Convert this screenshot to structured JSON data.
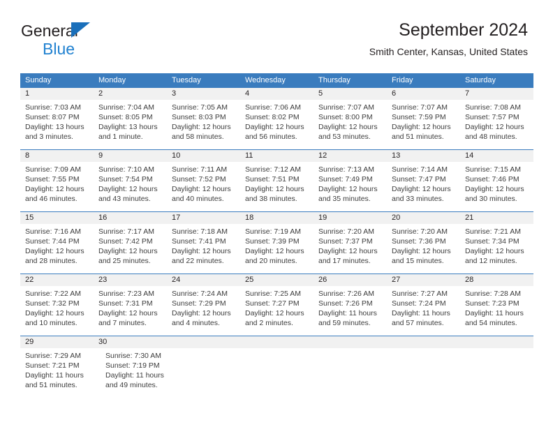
{
  "brand": {
    "name_part1": "General",
    "name_part2": "Blue",
    "triangle_color": "#1a6fba",
    "blue_color": "#2081d0"
  },
  "header": {
    "title": "September 2024",
    "subtitle": "Smith Center, Kansas, United States"
  },
  "theme": {
    "header_blue": "#3a7cbe",
    "daynum_gray": "#f1f1f1",
    "text_dark": "#231f20",
    "text_body": "#3c3c3c"
  },
  "weekdays": [
    "Sunday",
    "Monday",
    "Tuesday",
    "Wednesday",
    "Thursday",
    "Friday",
    "Saturday"
  ],
  "weeks": [
    {
      "days": [
        {
          "number": "1",
          "sunrise": "Sunrise: 7:03 AM",
          "sunset": "Sunset: 8:07 PM",
          "daylight_line1": "Daylight: 13 hours",
          "daylight_line2": "and 3 minutes."
        },
        {
          "number": "2",
          "sunrise": "Sunrise: 7:04 AM",
          "sunset": "Sunset: 8:05 PM",
          "daylight_line1": "Daylight: 13 hours",
          "daylight_line2": "and 1 minute."
        },
        {
          "number": "3",
          "sunrise": "Sunrise: 7:05 AM",
          "sunset": "Sunset: 8:03 PM",
          "daylight_line1": "Daylight: 12 hours",
          "daylight_line2": "and 58 minutes."
        },
        {
          "number": "4",
          "sunrise": "Sunrise: 7:06 AM",
          "sunset": "Sunset: 8:02 PM",
          "daylight_line1": "Daylight: 12 hours",
          "daylight_line2": "and 56 minutes."
        },
        {
          "number": "5",
          "sunrise": "Sunrise: 7:07 AM",
          "sunset": "Sunset: 8:00 PM",
          "daylight_line1": "Daylight: 12 hours",
          "daylight_line2": "and 53 minutes."
        },
        {
          "number": "6",
          "sunrise": "Sunrise: 7:07 AM",
          "sunset": "Sunset: 7:59 PM",
          "daylight_line1": "Daylight: 12 hours",
          "daylight_line2": "and 51 minutes."
        },
        {
          "number": "7",
          "sunrise": "Sunrise: 7:08 AM",
          "sunset": "Sunset: 7:57 PM",
          "daylight_line1": "Daylight: 12 hours",
          "daylight_line2": "and 48 minutes."
        }
      ]
    },
    {
      "days": [
        {
          "number": "8",
          "sunrise": "Sunrise: 7:09 AM",
          "sunset": "Sunset: 7:55 PM",
          "daylight_line1": "Daylight: 12 hours",
          "daylight_line2": "and 46 minutes."
        },
        {
          "number": "9",
          "sunrise": "Sunrise: 7:10 AM",
          "sunset": "Sunset: 7:54 PM",
          "daylight_line1": "Daylight: 12 hours",
          "daylight_line2": "and 43 minutes."
        },
        {
          "number": "10",
          "sunrise": "Sunrise: 7:11 AM",
          "sunset": "Sunset: 7:52 PM",
          "daylight_line1": "Daylight: 12 hours",
          "daylight_line2": "and 40 minutes."
        },
        {
          "number": "11",
          "sunrise": "Sunrise: 7:12 AM",
          "sunset": "Sunset: 7:51 PM",
          "daylight_line1": "Daylight: 12 hours",
          "daylight_line2": "and 38 minutes."
        },
        {
          "number": "12",
          "sunrise": "Sunrise: 7:13 AM",
          "sunset": "Sunset: 7:49 PM",
          "daylight_line1": "Daylight: 12 hours",
          "daylight_line2": "and 35 minutes."
        },
        {
          "number": "13",
          "sunrise": "Sunrise: 7:14 AM",
          "sunset": "Sunset: 7:47 PM",
          "daylight_line1": "Daylight: 12 hours",
          "daylight_line2": "and 33 minutes."
        },
        {
          "number": "14",
          "sunrise": "Sunrise: 7:15 AM",
          "sunset": "Sunset: 7:46 PM",
          "daylight_line1": "Daylight: 12 hours",
          "daylight_line2": "and 30 minutes."
        }
      ]
    },
    {
      "days": [
        {
          "number": "15",
          "sunrise": "Sunrise: 7:16 AM",
          "sunset": "Sunset: 7:44 PM",
          "daylight_line1": "Daylight: 12 hours",
          "daylight_line2": "and 28 minutes."
        },
        {
          "number": "16",
          "sunrise": "Sunrise: 7:17 AM",
          "sunset": "Sunset: 7:42 PM",
          "daylight_line1": "Daylight: 12 hours",
          "daylight_line2": "and 25 minutes."
        },
        {
          "number": "17",
          "sunrise": "Sunrise: 7:18 AM",
          "sunset": "Sunset: 7:41 PM",
          "daylight_line1": "Daylight: 12 hours",
          "daylight_line2": "and 22 minutes."
        },
        {
          "number": "18",
          "sunrise": "Sunrise: 7:19 AM",
          "sunset": "Sunset: 7:39 PM",
          "daylight_line1": "Daylight: 12 hours",
          "daylight_line2": "and 20 minutes."
        },
        {
          "number": "19",
          "sunrise": "Sunrise: 7:20 AM",
          "sunset": "Sunset: 7:37 PM",
          "daylight_line1": "Daylight: 12 hours",
          "daylight_line2": "and 17 minutes."
        },
        {
          "number": "20",
          "sunrise": "Sunrise: 7:20 AM",
          "sunset": "Sunset: 7:36 PM",
          "daylight_line1": "Daylight: 12 hours",
          "daylight_line2": "and 15 minutes."
        },
        {
          "number": "21",
          "sunrise": "Sunrise: 7:21 AM",
          "sunset": "Sunset: 7:34 PM",
          "daylight_line1": "Daylight: 12 hours",
          "daylight_line2": "and 12 minutes."
        }
      ]
    },
    {
      "days": [
        {
          "number": "22",
          "sunrise": "Sunrise: 7:22 AM",
          "sunset": "Sunset: 7:32 PM",
          "daylight_line1": "Daylight: 12 hours",
          "daylight_line2": "and 10 minutes."
        },
        {
          "number": "23",
          "sunrise": "Sunrise: 7:23 AM",
          "sunset": "Sunset: 7:31 PM",
          "daylight_line1": "Daylight: 12 hours",
          "daylight_line2": "and 7 minutes."
        },
        {
          "number": "24",
          "sunrise": "Sunrise: 7:24 AM",
          "sunset": "Sunset: 7:29 PM",
          "daylight_line1": "Daylight: 12 hours",
          "daylight_line2": "and 4 minutes."
        },
        {
          "number": "25",
          "sunrise": "Sunrise: 7:25 AM",
          "sunset": "Sunset: 7:27 PM",
          "daylight_line1": "Daylight: 12 hours",
          "daylight_line2": "and 2 minutes."
        },
        {
          "number": "26",
          "sunrise": "Sunrise: 7:26 AM",
          "sunset": "Sunset: 7:26 PM",
          "daylight_line1": "Daylight: 11 hours",
          "daylight_line2": "and 59 minutes."
        },
        {
          "number": "27",
          "sunrise": "Sunrise: 7:27 AM",
          "sunset": "Sunset: 7:24 PM",
          "daylight_line1": "Daylight: 11 hours",
          "daylight_line2": "and 57 minutes."
        },
        {
          "number": "28",
          "sunrise": "Sunrise: 7:28 AM",
          "sunset": "Sunset: 7:23 PM",
          "daylight_line1": "Daylight: 11 hours",
          "daylight_line2": "and 54 minutes."
        }
      ]
    },
    {
      "days": [
        {
          "number": "29",
          "sunrise": "Sunrise: 7:29 AM",
          "sunset": "Sunset: 7:21 PM",
          "daylight_line1": "Daylight: 11 hours",
          "daylight_line2": "and 51 minutes."
        },
        {
          "number": "30",
          "sunrise": "Sunrise: 7:30 AM",
          "sunset": "Sunset: 7:19 PM",
          "daylight_line1": "Daylight: 11 hours",
          "daylight_line2": "and 49 minutes."
        }
      ]
    }
  ]
}
